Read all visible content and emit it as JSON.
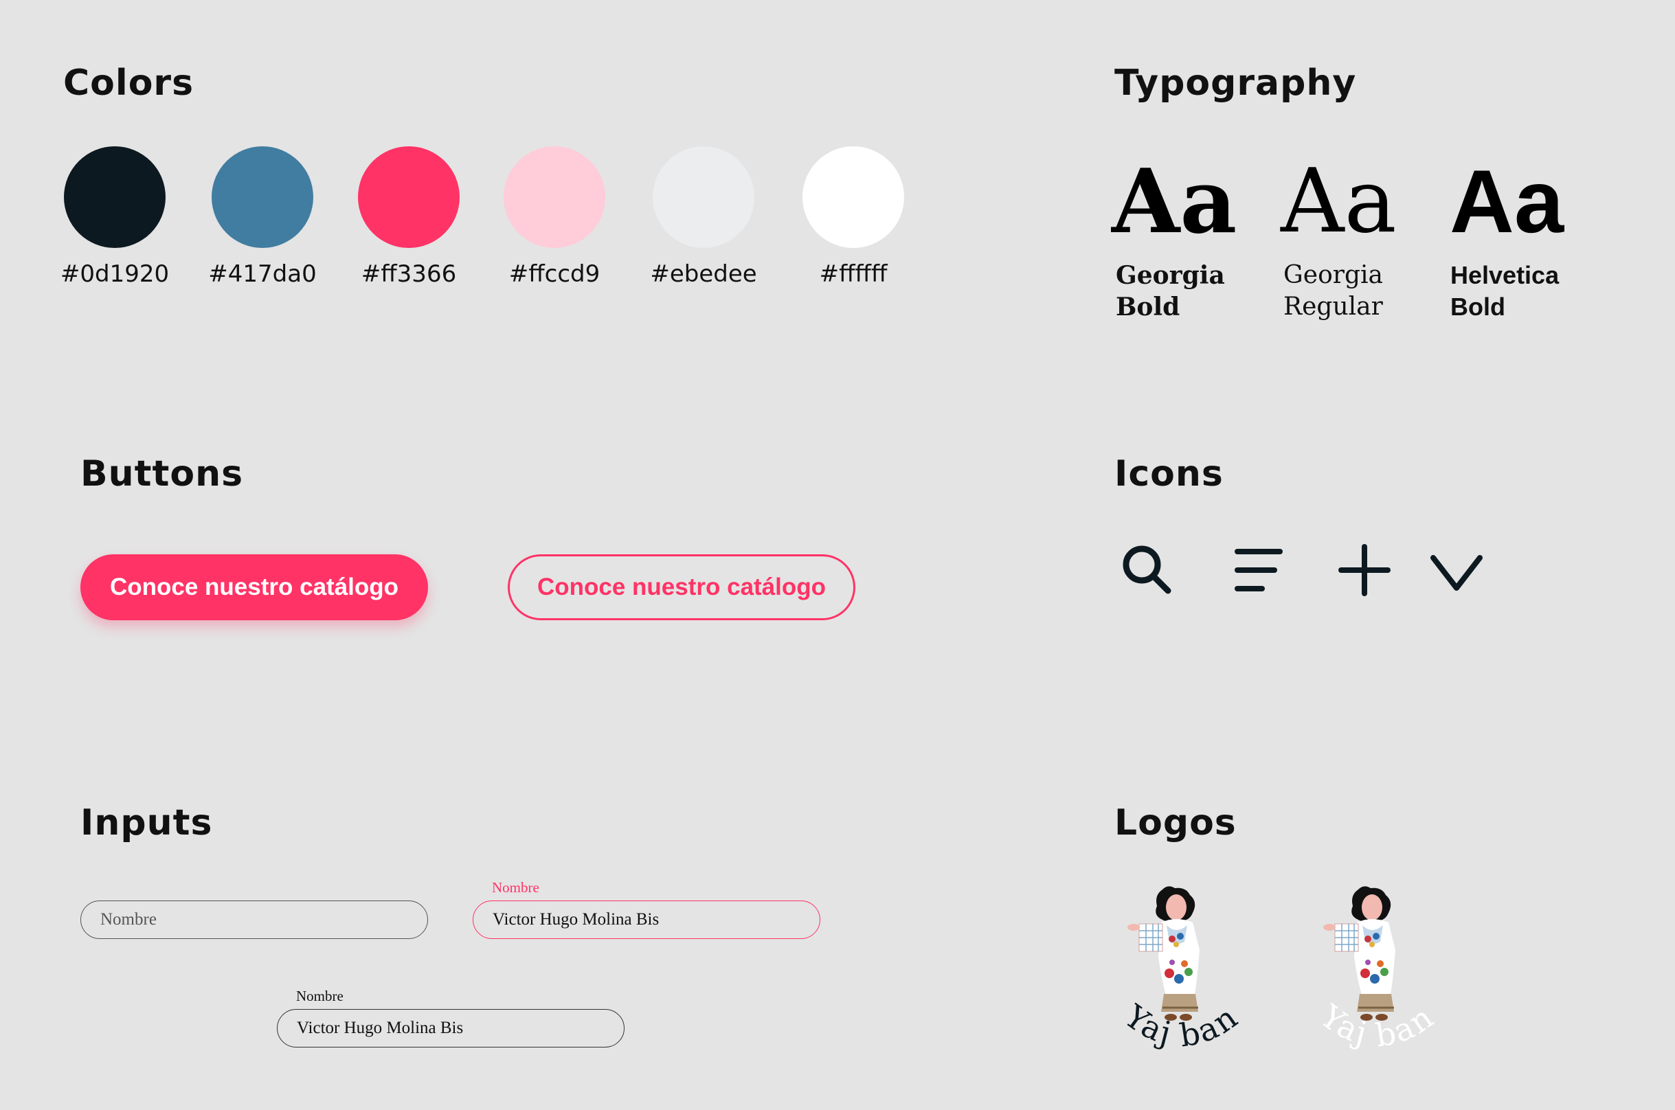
{
  "sections": {
    "colors": "Colors",
    "typography": "Typography",
    "buttons": "Buttons",
    "icons": "Icons",
    "inputs": "Inputs",
    "logos": "Logos"
  },
  "colors": [
    {
      "hex": "#0d1920",
      "label": "#0d1920"
    },
    {
      "hex": "#417da0",
      "label": "#417da0"
    },
    {
      "hex": "#ff3366",
      "label": "#ff3366"
    },
    {
      "hex": "#ffccd9",
      "label": "#ffccd9"
    },
    {
      "hex": "#ebedee",
      "label": "#ebedee"
    },
    {
      "hex": "#ffffff",
      "label": "#ffffff"
    }
  ],
  "typography": [
    {
      "sample": "Aa",
      "name_line1": "Georgia",
      "name_line2": "Bold"
    },
    {
      "sample": "Aa",
      "name_line1": "Georgia",
      "name_line2": "Regular"
    },
    {
      "sample": "Aa",
      "name_line1": "Helvetica",
      "name_line2": "Bold"
    }
  ],
  "buttons": {
    "primary_label": "Conoce nuestro catálogo",
    "secondary_label": "Conoce nuestro catálogo"
  },
  "icons": [
    "search-icon",
    "menu-icon",
    "plus-icon",
    "chevron-down-icon"
  ],
  "inputs": {
    "placeholder": "Nombre",
    "focused_label": "Nombre",
    "focused_value": "Victor Hugo Molina Bis",
    "filled_label": "Nombre",
    "filled_value": "Victor Hugo Molina Bis"
  },
  "logos": {
    "wordmark": "Yaj ban",
    "dark_text_color": "#0d1920",
    "light_text_color": "#ffffff"
  }
}
